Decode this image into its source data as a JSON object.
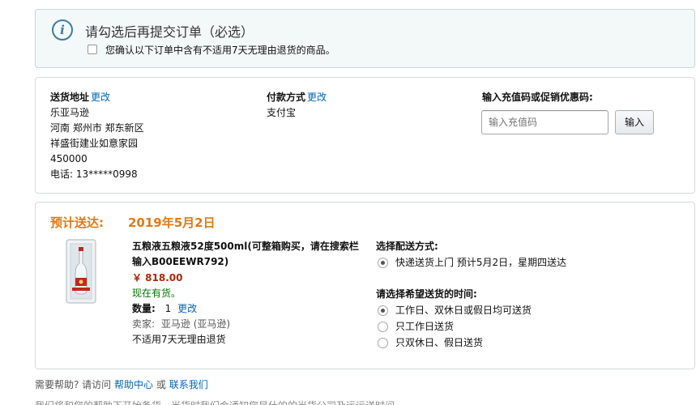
{
  "notice": {
    "title": "请勾选后再提交订单（必选）",
    "checkbox_text": "您确认以下订单中含有不适用7天无理由退货的商品。"
  },
  "address": {
    "label": "送货地址",
    "change": "更改",
    "lines": [
      "乐亚马逊",
      "河南 郑州市 郑东新区",
      "祥盛街建业如意家园",
      "450000",
      "电话: 13*****0998"
    ]
  },
  "payment": {
    "label": "付款方式",
    "change": "更改",
    "method": "支付宝"
  },
  "coupon": {
    "label": "输入充值码或促销优惠码:",
    "placeholder": "输入充值码",
    "button": "输入"
  },
  "shipment": {
    "deliver_label": "预计送达:",
    "deliver_date": "2019年5月2日",
    "product": {
      "title": "五粮液五粮液52度500ml(可整箱购买，请在搜索栏输入B00EEWR792)",
      "price": "￥ 818.00",
      "stock": "现在有货。",
      "qty_label": "数量:",
      "qty_value": "1",
      "qty_change": "更改",
      "seller_label": "卖家:",
      "seller_value": "亚马逊 (亚马逊)",
      "return_note": "不适用7天无理由退货"
    },
    "shipping_method": {
      "title": "选择配送方式:",
      "options": [
        {
          "label": "快递送货上门 预计5月2日，星期四送达",
          "selected": true
        }
      ]
    },
    "delivery_time": {
      "title": "请选择希望送货的时间:",
      "options": [
        {
          "label": "工作日、双休日或假日均可送货",
          "selected": true
        },
        {
          "label": "只工作日送货",
          "selected": false
        },
        {
          "label": "只双休日、假日送货",
          "selected": false
        }
      ]
    }
  },
  "help": {
    "prefix": "需要帮助? 请访问",
    "help_center": "帮助中心",
    "or": "或",
    "contact": "联系我们"
  },
  "bottom_text": "我们将和您的帮助下开始备货，当货时我们会通知您是什的的当货公司及运运送时间。"
}
